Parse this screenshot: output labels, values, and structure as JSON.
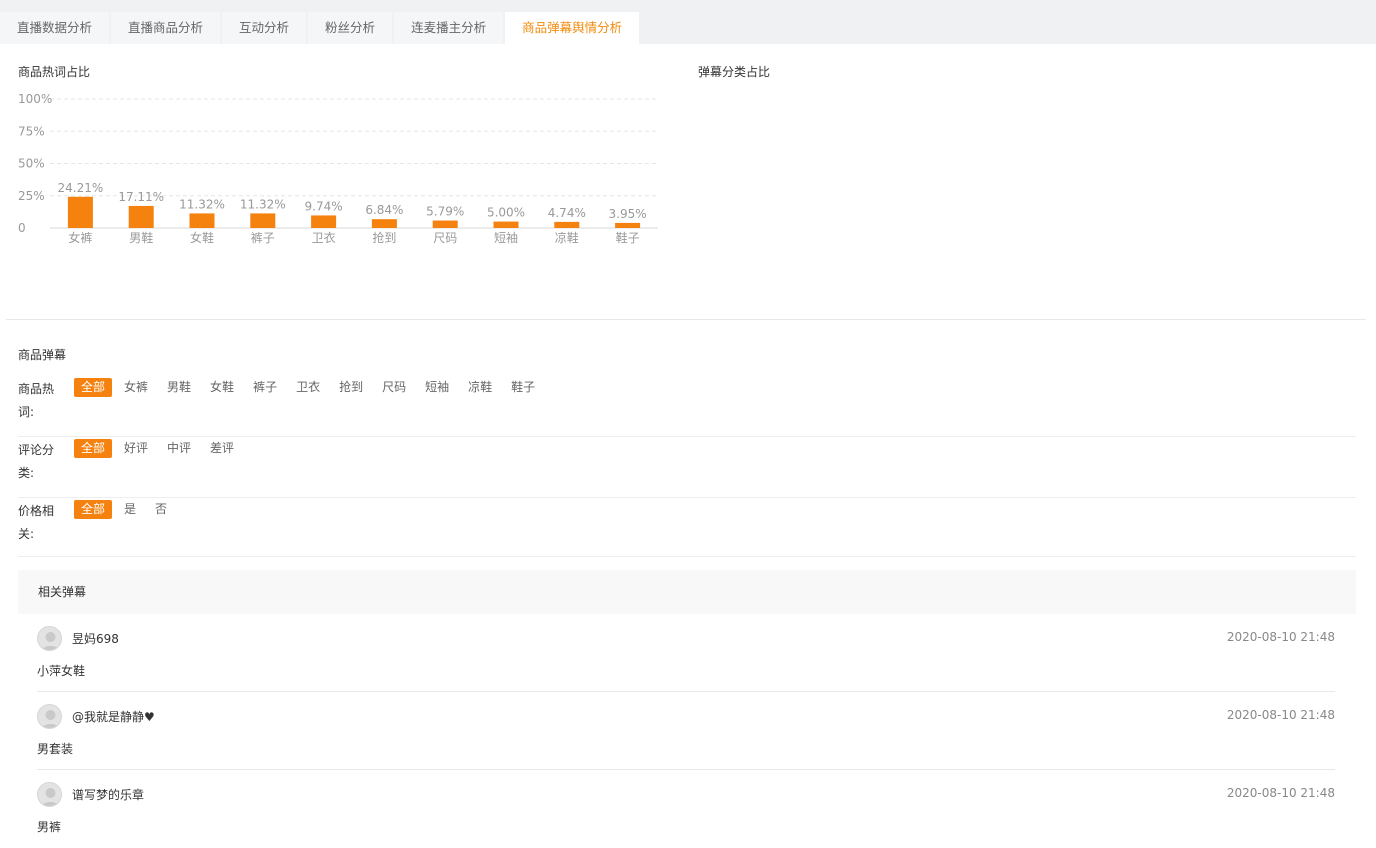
{
  "tabs": [
    {
      "label": "直播数据分析",
      "active": false
    },
    {
      "label": "直播商品分析",
      "active": false
    },
    {
      "label": "互动分析",
      "active": false
    },
    {
      "label": "粉丝分析",
      "active": false
    },
    {
      "label": "连麦播主分析",
      "active": false
    },
    {
      "label": "商品弹幕舆情分析",
      "active": true
    }
  ],
  "hotword_section": {
    "title": "商品热词占比"
  },
  "category_section": {
    "title": "弹幕分类占比"
  },
  "chart_data": {
    "type": "bar",
    "categories": [
      "女裤",
      "男鞋",
      "女鞋",
      "裤子",
      "卫衣",
      "抢到",
      "尺码",
      "短袖",
      "凉鞋",
      "鞋子"
    ],
    "values": [
      24.21,
      17.11,
      11.32,
      11.32,
      9.74,
      6.84,
      5.79,
      5.0,
      4.74,
      3.95
    ],
    "value_labels": [
      "24.21%",
      "17.11%",
      "11.32%",
      "11.32%",
      "9.74%",
      "6.84%",
      "5.79%",
      "5.00%",
      "4.74%",
      "3.95%"
    ],
    "y_ticks": [
      0,
      25,
      50,
      75,
      100
    ],
    "y_tick_labels": [
      "0",
      "25%",
      "50%",
      "75%",
      "100%"
    ],
    "ylim": [
      0,
      100
    ],
    "grid": true,
    "bar_color": "#f5820f"
  },
  "danmu_section": {
    "title": "商品弹幕"
  },
  "filters": [
    {
      "label": "商品热词:",
      "options": [
        "全部",
        "女裤",
        "男鞋",
        "女鞋",
        "裤子",
        "卫衣",
        "抢到",
        "尺码",
        "短袖",
        "凉鞋",
        "鞋子"
      ],
      "selected": 0
    },
    {
      "label": "评论分类:",
      "options": [
        "全部",
        "好评",
        "中评",
        "差评"
      ],
      "selected": 0
    },
    {
      "label": "价格相关:",
      "options": [
        "全部",
        "是",
        "否"
      ],
      "selected": 0
    }
  ],
  "comments_header": "相关弹幕",
  "comments": [
    {
      "user": "昱妈698",
      "time": "2020-08-10 21:48",
      "text": "小萍女鞋"
    },
    {
      "user": "@我就是静静♥",
      "time": "2020-08-10 21:48",
      "text": "男套装"
    },
    {
      "user": "谱写梦的乐章",
      "time": "2020-08-10 21:48",
      "text": "男裤"
    }
  ],
  "colors": {
    "accent": "#f38b0c",
    "bar": "#f5820f"
  }
}
